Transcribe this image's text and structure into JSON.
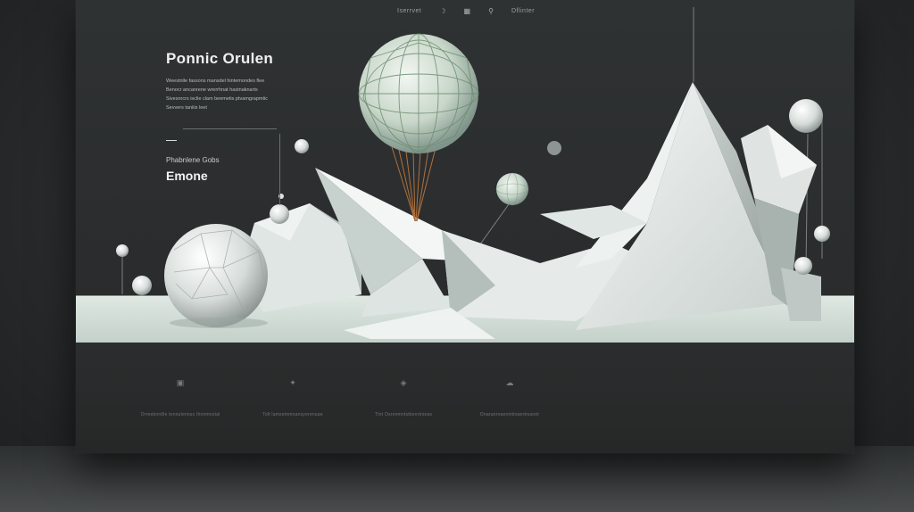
{
  "nav": {
    "items": [
      "Iserrvet",
      "Dflinter"
    ],
    "icons": [
      "crescent-icon",
      "grid-icon",
      "search-icon"
    ]
  },
  "hero": {
    "title": "Ponnic Orulen",
    "description_lines": [
      "Weestnlle fassons mansdel hintemondes flee",
      "Benocr ancanrene wrerrhnat hastnaknarts",
      "Sivesnrcrs isclie clam beemetis ptvamgrapmtic",
      "Sevvers taniiis leet"
    ],
    "eyebrow": "Phabnlene Gobs",
    "subtitle": "Emone"
  },
  "features": [
    {
      "icon": "archive-icon",
      "text": "Orreebnntlle tenoulennss Ihnnmnstal"
    },
    {
      "icon": "bird-icon",
      "text": "Tolt lamsetnmnansyenrnuae"
    },
    {
      "icon": "box-icon",
      "text": "Ttnt Osrenmntsttienrtnieas"
    },
    {
      "icon": "cloud-icon",
      "text": "Onaranrnaenmitoanrtnuestr"
    }
  ],
  "colors": {
    "background": "#2a2c2d",
    "frame": "#2f3233",
    "ground": "#d3ddd8",
    "sphere_green": "#cfdccf",
    "rope": "#b0713c"
  }
}
